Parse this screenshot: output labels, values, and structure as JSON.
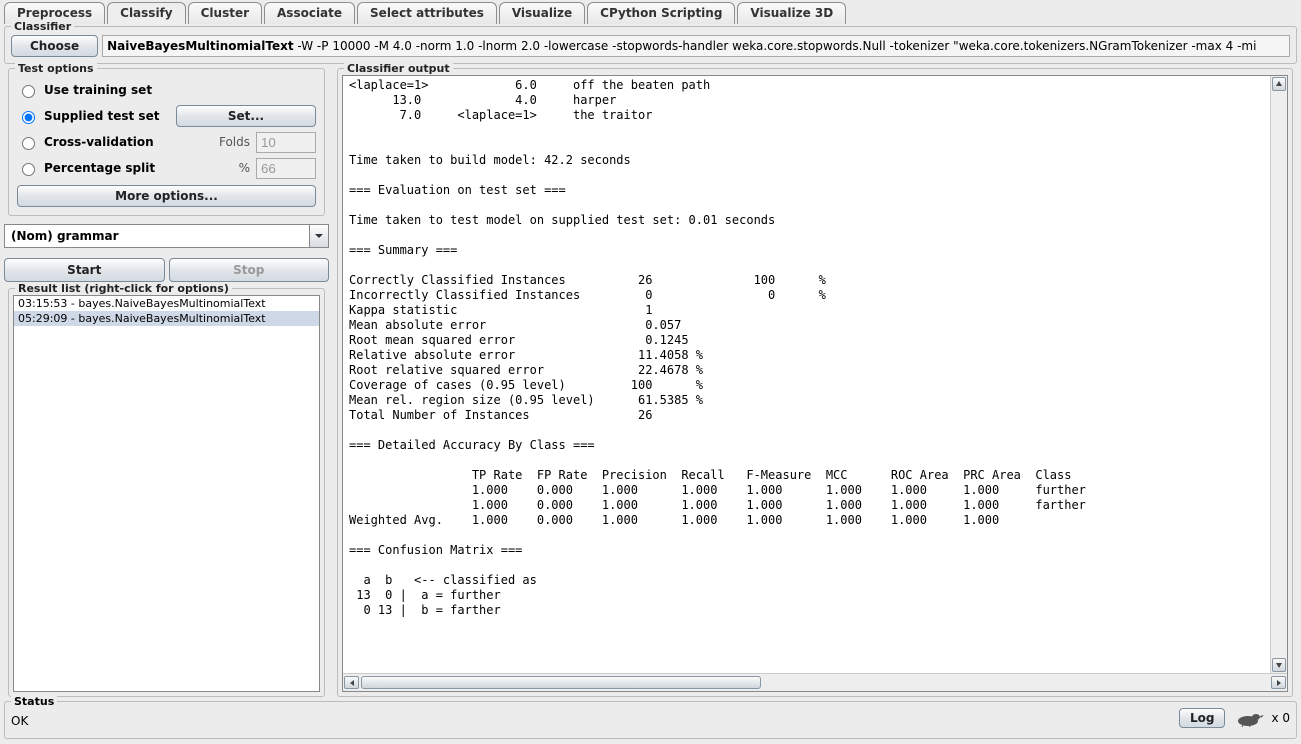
{
  "tabs": [
    "Preprocess",
    "Classify",
    "Cluster",
    "Associate",
    "Select attributes",
    "Visualize",
    "CPython Scripting",
    "Visualize 3D"
  ],
  "activeTab": "Classify",
  "classifier": {
    "group_title": "Classifier",
    "choose_label": "Choose",
    "name": "NaiveBayesMultinomialText",
    "args": " -W -P 10000 -M 4.0 -norm 1.0 -lnorm 2.0 -lowercase -stopwords-handler weka.core.stopwords.Null -tokenizer \"weka.core.tokenizers.NGramTokenizer -max 4 -mi"
  },
  "test_options": {
    "group_title": "Test options",
    "use_training": "Use training set",
    "supplied": "Supplied test set",
    "set_button": "Set...",
    "cv": "Cross-validation",
    "folds_label": "Folds",
    "folds_value": "10",
    "pct": "Percentage split",
    "pct_label": "%",
    "pct_value": "66",
    "more": "More options..."
  },
  "attr_combo": "(Nom) grammar",
  "start_label": "Start",
  "stop_label": "Stop",
  "result_title": "Result list (right-click for options)",
  "results": [
    "03:15:53 - bayes.NaiveBayesMultinomialText",
    "05:29:09 - bayes.NaiveBayesMultinomialText"
  ],
  "output_title": "Classifier output",
  "output_text": "<laplace=1>            6.0     off the beaten path\n      13.0             4.0     harper\n       7.0     <laplace=1>     the traitor\n\n\nTime taken to build model: 42.2 seconds\n\n=== Evaluation on test set ===\n\nTime taken to test model on supplied test set: 0.01 seconds\n\n=== Summary ===\n\nCorrectly Classified Instances          26              100      %\nIncorrectly Classified Instances         0                0      %\nKappa statistic                          1     \nMean absolute error                      0.057 \nRoot mean squared error                  0.1245\nRelative absolute error                 11.4058 %\nRoot relative squared error             22.4678 %\nCoverage of cases (0.95 level)         100      %\nMean rel. region size (0.95 level)      61.5385 %\nTotal Number of Instances               26     \n\n=== Detailed Accuracy By Class ===\n\n                 TP Rate  FP Rate  Precision  Recall   F-Measure  MCC      ROC Area  PRC Area  Class\n                 1.000    0.000    1.000      1.000    1.000      1.000    1.000     1.000     further\n                 1.000    0.000    1.000      1.000    1.000      1.000    1.000     1.000     farther\nWeighted Avg.    1.000    0.000    1.000      1.000    1.000      1.000    1.000     1.000     \n\n=== Confusion Matrix ===\n\n  a  b   <-- classified as\n 13  0 |  a = further\n  0 13 |  b = farther\n",
  "status": {
    "title": "Status",
    "text": "OK",
    "log": "Log",
    "count": "x 0"
  }
}
